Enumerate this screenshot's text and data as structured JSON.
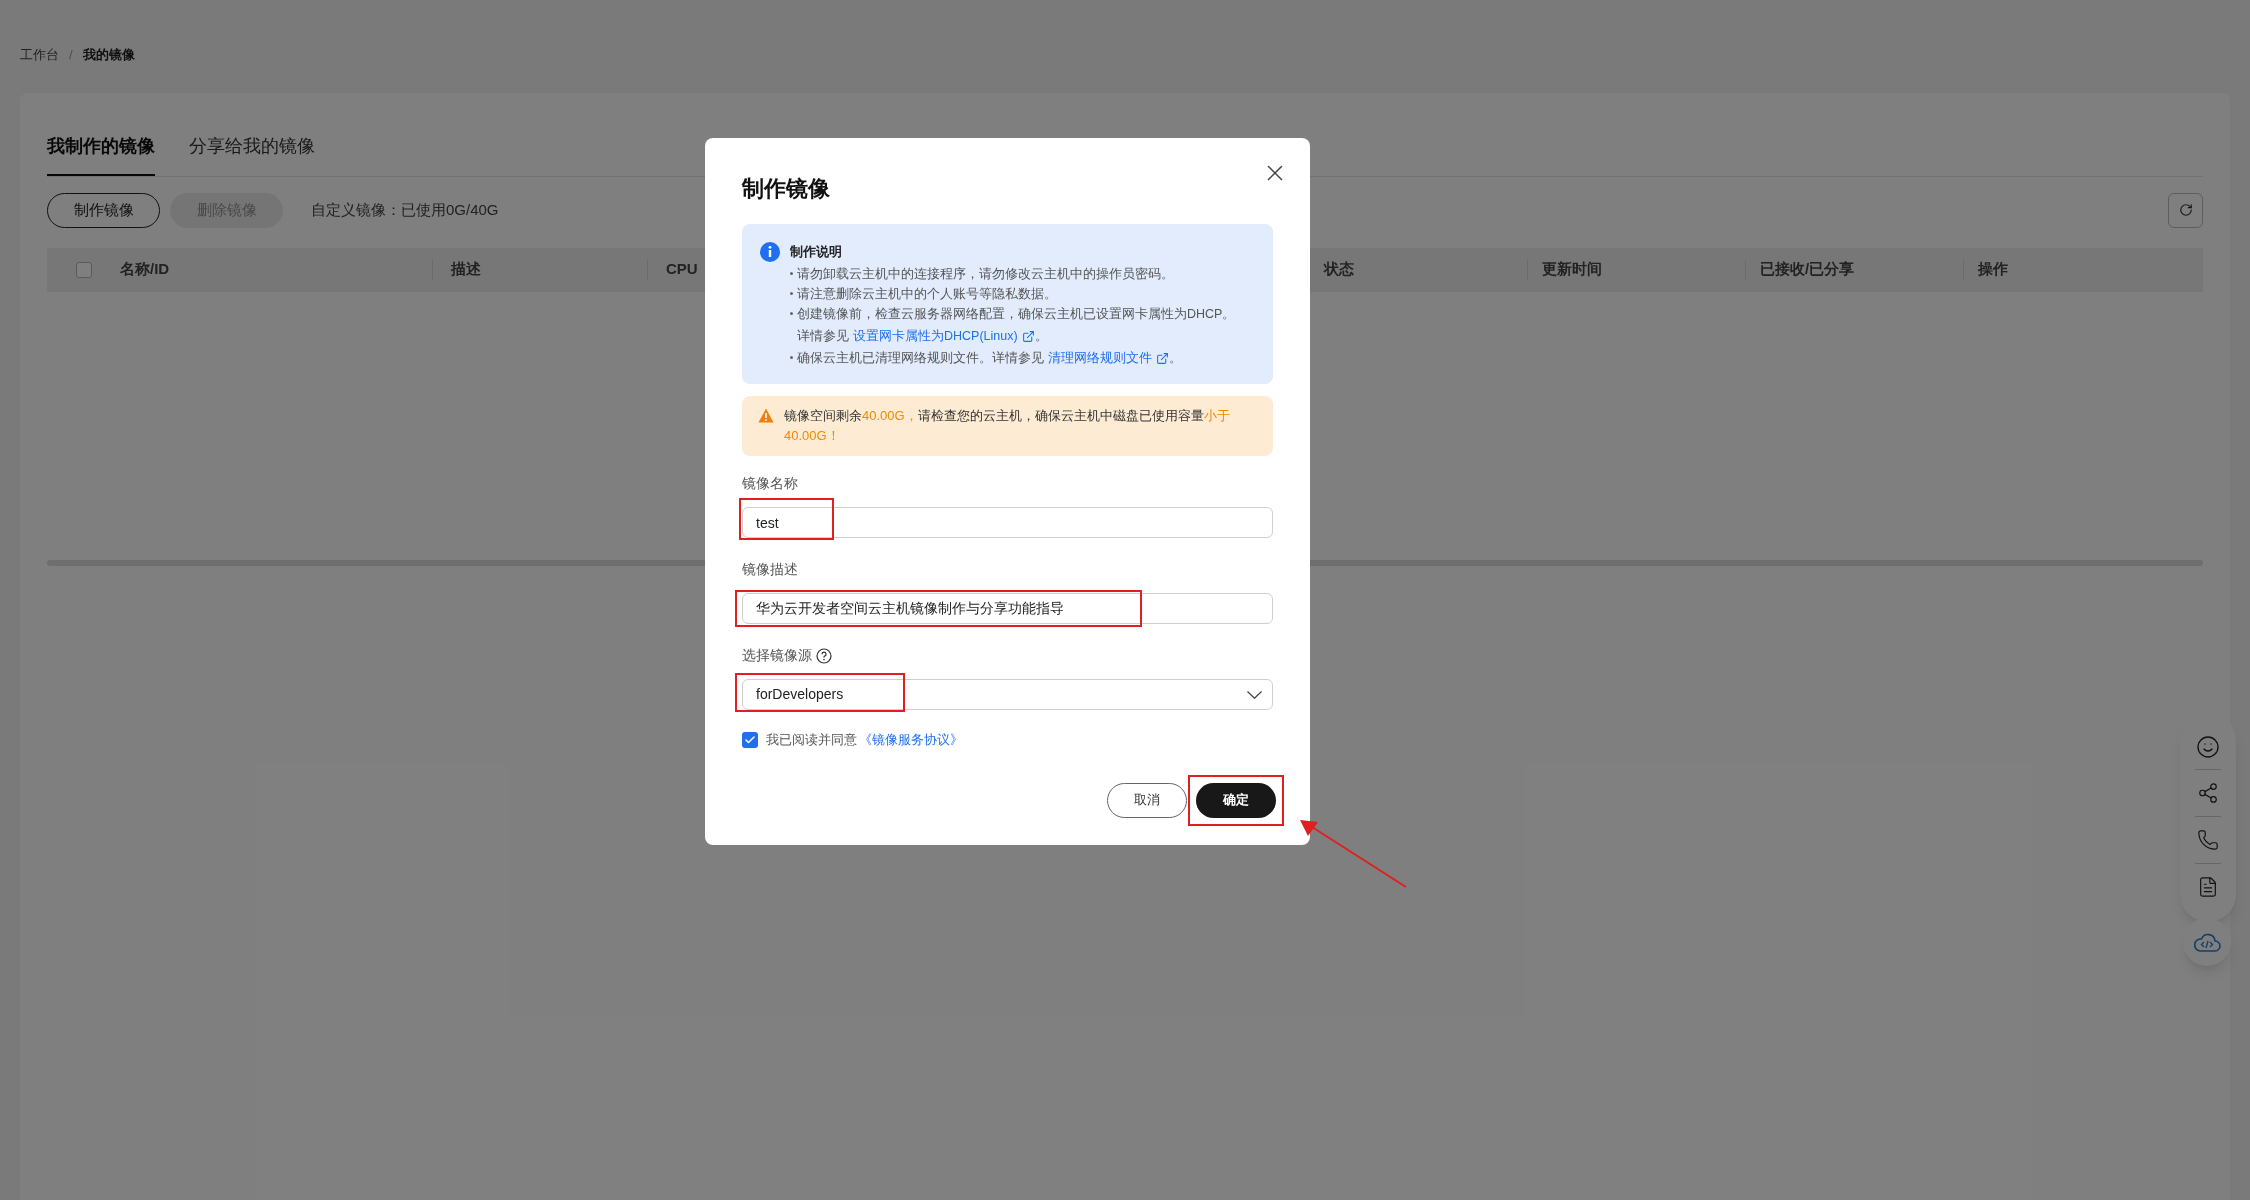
{
  "breadcrumb": [
    {
      "label": "工作台",
      "current": false
    },
    {
      "label": "我的镜像",
      "current": true
    }
  ],
  "breadcrumb_separator": "/",
  "tabs": [
    {
      "label": "我制作的镜像",
      "selected": true
    },
    {
      "label": "分享给我的镜像",
      "selected": false
    }
  ],
  "toolbar": {
    "buttons": [
      {
        "label": "制作镜像",
        "disabled": false
      },
      {
        "label": "删除镜像",
        "disabled": true
      }
    ],
    "quota": "自定义镜像：已使用0G/40G"
  },
  "table": {
    "select_all_checked": false,
    "columns_left": [
      "名称/ID",
      "描述",
      "CPU"
    ],
    "columns_right": [
      "状态",
      "更新时间",
      "已接收/已分享",
      "操作"
    ]
  },
  "dialog": {
    "title": "制作镜像",
    "info": {
      "title": "制作说明",
      "items": [
        {
          "text": "请勿卸载云主机中的连接程序，请勿修改云主机中的操作员密码。"
        },
        {
          "text": "请注意删除云主机中的个人账号等隐私数据。"
        },
        {
          "text": "创建镜像前，检查云服务器网络配置，确保云主机已设置网卡属性为DHCP。",
          "continuation": {
            "text": "详情参见",
            "link": "设置网卡属性为DHCP(Linux)",
            "suffix": "。"
          }
        },
        {
          "text": "确保云主机已清理网络规则文件。详情参见",
          "link": "清理网络规则文件",
          "suffix": "。"
        }
      ]
    },
    "warning": [
      {
        "text": "镜像空间剩余",
        "highlight": false
      },
      {
        "text": "40.00G，",
        "highlight": true
      },
      {
        "text": "请检查您的云主机，确保云主机中磁盘已使用容量",
        "highlight": false
      },
      {
        "text": "小于40.00G！",
        "highlight": true
      }
    ],
    "fields": [
      {
        "kind": "input",
        "label": "镜像名称",
        "value": "test"
      },
      {
        "kind": "input",
        "label": "镜像描述",
        "value": "华为云开发者空间云主机镜像制作与分享功能指导"
      },
      {
        "kind": "select",
        "label": "选择镜像源",
        "help": true,
        "value": "forDevelopers"
      }
    ],
    "agreement": {
      "checked": true,
      "text": "我已阅读并同意",
      "link": "《镜像服务协议》"
    },
    "buttons": [
      {
        "label": "取消",
        "primary": false
      },
      {
        "label": "确定",
        "primary": true
      }
    ]
  }
}
